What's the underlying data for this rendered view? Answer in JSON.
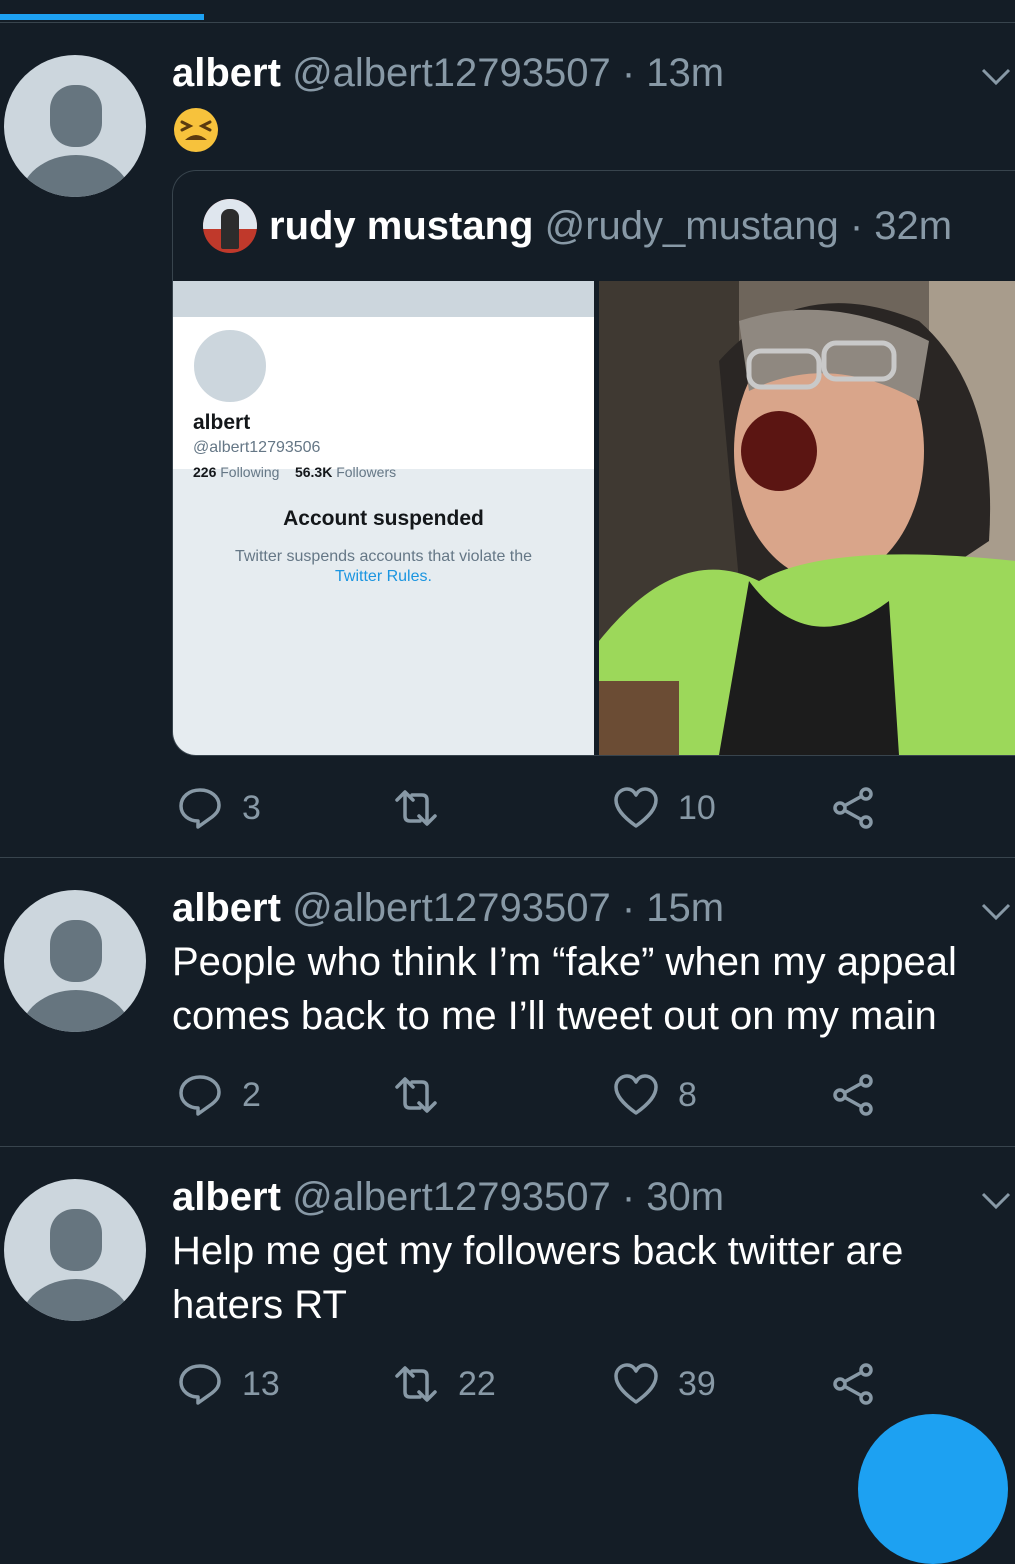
{
  "tweets": [
    {
      "name": "albert",
      "handle": "@albert12793507",
      "time": "13m",
      "emoji": "tired-face-emoji",
      "quote": {
        "name": "rudy mustang",
        "handle": "@rudy_mustang",
        "time": "32m",
        "screenshot": {
          "name": "albert",
          "handle": "@albert12793506",
          "following_count": "226",
          "following_label": "Following",
          "followers_count": "56.3K",
          "followers_label": "Followers",
          "title": "Account suspended",
          "desc": "Twitter suspends accounts that violate the",
          "rules_link": "Twitter Rules."
        },
        "photo": "crying-woman-photo"
      },
      "replies": "3",
      "retweets": "",
      "likes": "10"
    },
    {
      "name": "albert",
      "handle": "@albert12793507",
      "time": "15m",
      "text": "People who think I’m “fake” when my appeal comes back to me I’ll tweet out on my main",
      "replies": "2",
      "retweets": "",
      "likes": "8"
    },
    {
      "name": "albert",
      "handle": "@albert12793507",
      "time": "30m",
      "text": "Help me get my followers back twitter are haters RT",
      "replies": "13",
      "retweets": "22",
      "likes": "39"
    }
  ],
  "colors": {
    "background": "#141d26",
    "accent": "#1da1f2",
    "secondary_text": "#8899a6"
  }
}
